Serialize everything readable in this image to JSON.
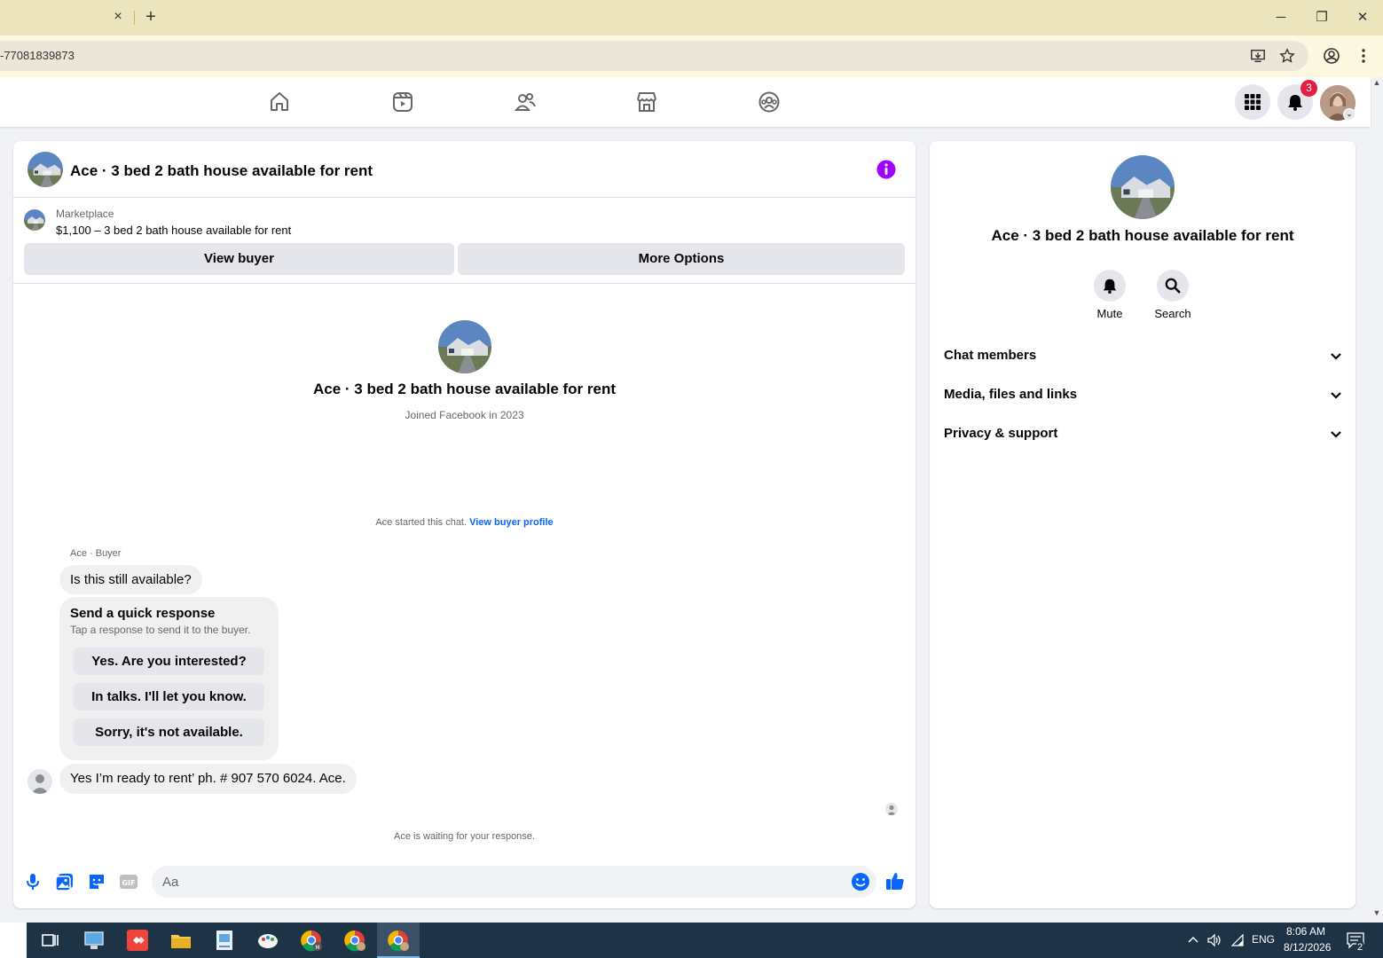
{
  "browser": {
    "url": "-77081839873",
    "tab_close": "×",
    "new_tab": "+",
    "minimize": "─",
    "restore": "❐",
    "close": "✕"
  },
  "nav": {
    "notification_count": "3",
    "profile_caret": "⌄"
  },
  "chat": {
    "title": "Ace · 3 bed 2 bath house available for rent",
    "marketplace_label": "Marketplace",
    "listing": "$1,100 – 3 bed 2 bath house available for rent",
    "view_buyer_label": "View buyer",
    "more_options_label": "More Options",
    "intro_name": "Ace · 3 bed 2 bath house available for rent",
    "intro_joined": "Joined Facebook in 2023",
    "started_text": "Ace started this chat.",
    "started_link": "View buyer profile",
    "sender_label": "Ace · Buyer",
    "message_1": "Is this still available?",
    "quick_response_title": "Send a quick response",
    "quick_response_subtitle": "Tap a response to send it to the buyer.",
    "quick_responses": [
      "Yes. Are you interested?",
      "In talks. I'll let you know.",
      "Sorry, it's not available."
    ],
    "message_2": "Yes I’m ready to rent’ ph. # 907 570 6024.  Ace.",
    "waiting_text": "Ace is waiting for your response.",
    "composer_placeholder": "Aa"
  },
  "right_panel": {
    "title": "Ace · 3 bed 2 bath house available for rent",
    "mute_label": "Mute",
    "search_label": "Search",
    "rows": [
      "Chat members",
      "Media, files and links",
      "Privacy & support"
    ]
  },
  "taskbar": {
    "language": "ENG",
    "time": "8:06 AM",
    "date": "8/12/2026",
    "notification_count": "2"
  },
  "colors": {
    "accent_blue": "#0866ff",
    "info_purple": "#a200ff",
    "badge_red": "#e41e3f",
    "tab_bar": "#ebe4bd"
  }
}
